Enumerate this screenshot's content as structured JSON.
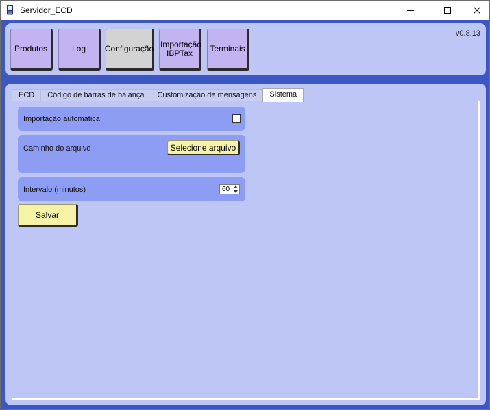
{
  "window": {
    "title": "Servidor_ECD"
  },
  "header": {
    "version": "v0.8.13",
    "nav": [
      {
        "label": "Produtos"
      },
      {
        "label": "Log"
      },
      {
        "label": "Configuração"
      },
      {
        "label": "Importação IBPTax"
      },
      {
        "label": "Terminais"
      }
    ],
    "active_nav": "Configuração"
  },
  "tabs": [
    {
      "label": "ECD"
    },
    {
      "label": "Código de barras de balança"
    },
    {
      "label": "Customização de mensagens"
    },
    {
      "label": "Sistema"
    }
  ],
  "active_tab": "Sistema",
  "sistema": {
    "auto_import": {
      "label": "Importação automática",
      "checked": false
    },
    "file_path": {
      "label": "Caminho do arquivo",
      "button_label": "Selecione arquivo"
    },
    "interval": {
      "label": "Intervalo (minutos)",
      "value": "60"
    },
    "save_label": "Salvar"
  },
  "icons": {
    "app": "phone-app-icon",
    "minimize": "minimize-icon",
    "maximize": "maximize-icon",
    "close": "close-icon"
  },
  "colors": {
    "window_bg": "#3a57c4",
    "panel_bg": "#bdc6f5",
    "group_bg": "#8d9df3",
    "nav_button": "#c4b3f1",
    "nav_active": "#d3d3d3",
    "action_button": "#f6f3a6"
  }
}
